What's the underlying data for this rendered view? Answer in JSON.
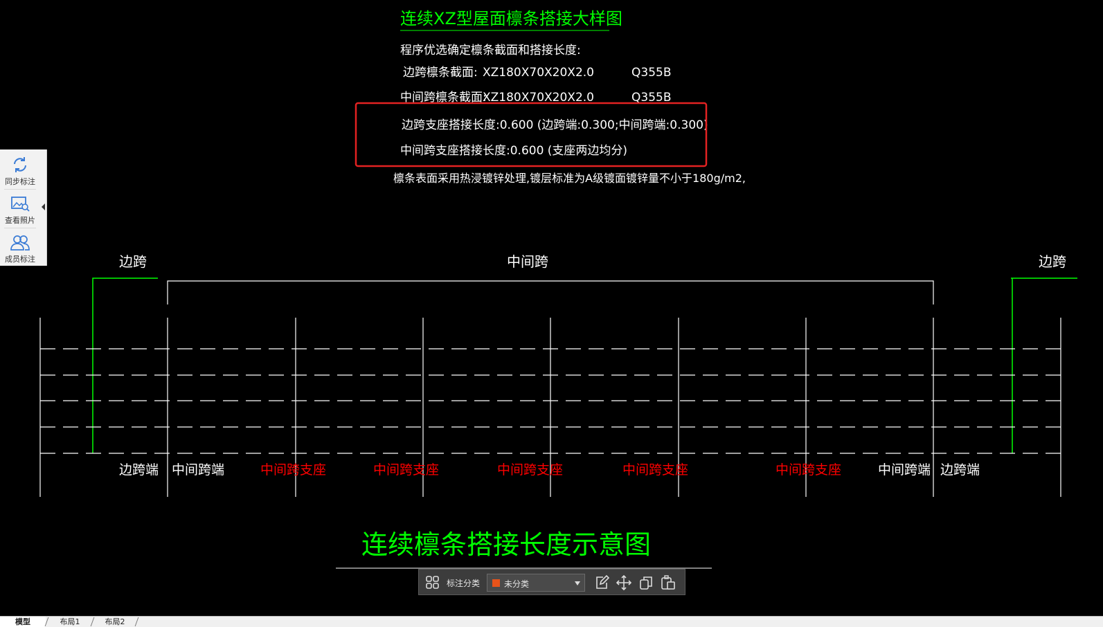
{
  "drawing": {
    "title": "连续XZ型屋面檩条搭接大样图",
    "intro": "程序优选确定檩条截面和搭接长度:",
    "edge_span_section": {
      "label": "边跨檩条截面:",
      "size": "XZ180X70X20X2.0",
      "grade": "Q355B"
    },
    "mid_span_section": {
      "label": "中间跨檩条截面:",
      "size": "XZ180X70X20X2.0",
      "grade": "Q355B"
    },
    "edge_support_lap": "边跨支座搭接长度:0.600 (边跨端:0.300;中间跨端:0.300)",
    "mid_support_lap": "中间跨支座搭接长度:0.600 (支座两边均分)",
    "coating_note": "檩条表面采用热浸镀锌处理,镀层标准为A级镀面镀锌量不小于180g/m2,",
    "span_labels": {
      "left": "边跨",
      "middle": "中间跨",
      "right": "边跨"
    },
    "bottom_labels": [
      "边跨端",
      "中间跨端",
      "中间跨支座",
      "中间跨支座",
      "中间跨支座",
      "中间跨支座",
      "中间跨支座",
      "中间跨端",
      "边跨端"
    ],
    "diagram_title": "连续檩条搭接长度示意图"
  },
  "colors": {
    "green": "#00ff00",
    "white": "#ffffff",
    "red": "#ff0000",
    "highlight": "#e32222",
    "swatch": "#e8531a"
  },
  "left_toolbar": {
    "items": [
      {
        "label": "同步标注",
        "icon": "sync-icon"
      },
      {
        "label": "查看照片",
        "icon": "photo-search-icon"
      },
      {
        "label": "成员标注",
        "icon": "members-icon"
      }
    ]
  },
  "annotation_toolbar": {
    "label": "标注分类",
    "selected": "未分类",
    "icons": [
      "grid-icon",
      "edit-icon",
      "move-icon",
      "copy-icon",
      "paste-icon"
    ]
  },
  "tabs": [
    "模型",
    "布局1",
    "布局2"
  ]
}
